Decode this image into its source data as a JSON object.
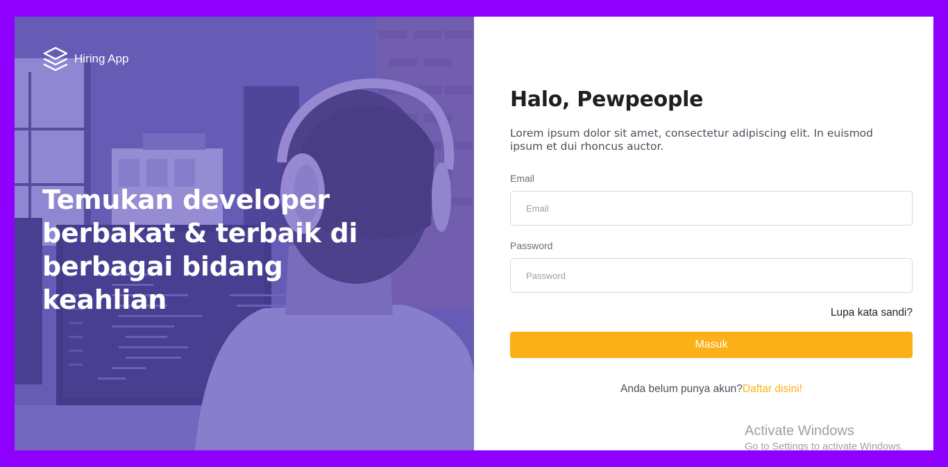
{
  "brand": {
    "name": "Hiring App",
    "icon": "layers-icon"
  },
  "hero": {
    "headline": "Temukan developer berbakat & terbaik di berbagai bidang keahlian"
  },
  "login": {
    "greeting": "Halo, Pewpeople",
    "subtitle": "Lorem ipsum dolor sit amet, consectetur adipiscing elit. In euismod ipsum et dui rhoncus auctor.",
    "email_label": "Email",
    "email_placeholder": "Email",
    "email_value": "",
    "password_label": "Password",
    "password_placeholder": "Password",
    "password_value": "",
    "forgot_label": "Lupa kata sandi?",
    "submit_label": "Masuk",
    "register_prompt": "Anda belum punya akun?",
    "register_link": "Daftar disini!"
  },
  "watermark": {
    "title": "Activate Windows",
    "subtitle": "Go to Settings to activate Windows."
  },
  "colors": {
    "frame": "#8f00ff",
    "overlay": "#5e50bf",
    "accent": "#fbb017"
  }
}
